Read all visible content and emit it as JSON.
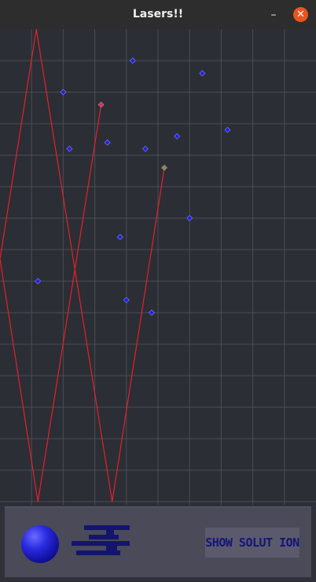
{
  "window": {
    "title": "Lasers!!",
    "minimize_label": "–",
    "close_label": "✕"
  },
  "panel": {
    "solution_button_label": "SHOW SOLUT ION",
    "ball_icon": "blue-orb-icon",
    "counter_icon": "pixel-digit-icon"
  },
  "colors": {
    "board_bg": "#2b2e34",
    "grid_line": "#4a4d55",
    "laser": "#e8202a",
    "mirror": "#2020e0",
    "source": "#e83030",
    "target": "#a08a10",
    "panel_bg": "#4a4a58",
    "accent": "#e95420"
  },
  "game": {
    "grid": {
      "cols": 10,
      "rows": 15
    },
    "laser_path": [
      [
        3.2,
        2.4
      ],
      [
        1.2,
        15.0
      ],
      [
        0.0,
        7.3
      ],
      [
        1.15,
        0.0
      ],
      [
        3.55,
        15.0
      ],
      [
        5.2,
        4.4
      ]
    ],
    "source": [
      3.2,
      2.4
    ],
    "target": [
      5.2,
      4.4
    ],
    "mirrors": [
      [
        4.2,
        1.0
      ],
      [
        6.4,
        1.4
      ],
      [
        2.0,
        2.0
      ],
      [
        2.2,
        3.8
      ],
      [
        3.4,
        3.6
      ],
      [
        4.6,
        3.8
      ],
      [
        5.6,
        3.4
      ],
      [
        7.2,
        3.2
      ],
      [
        6.0,
        6.0
      ],
      [
        3.8,
        6.6
      ],
      [
        1.2,
        8.0
      ],
      [
        4.0,
        8.6
      ],
      [
        4.8,
        9.0
      ]
    ]
  }
}
